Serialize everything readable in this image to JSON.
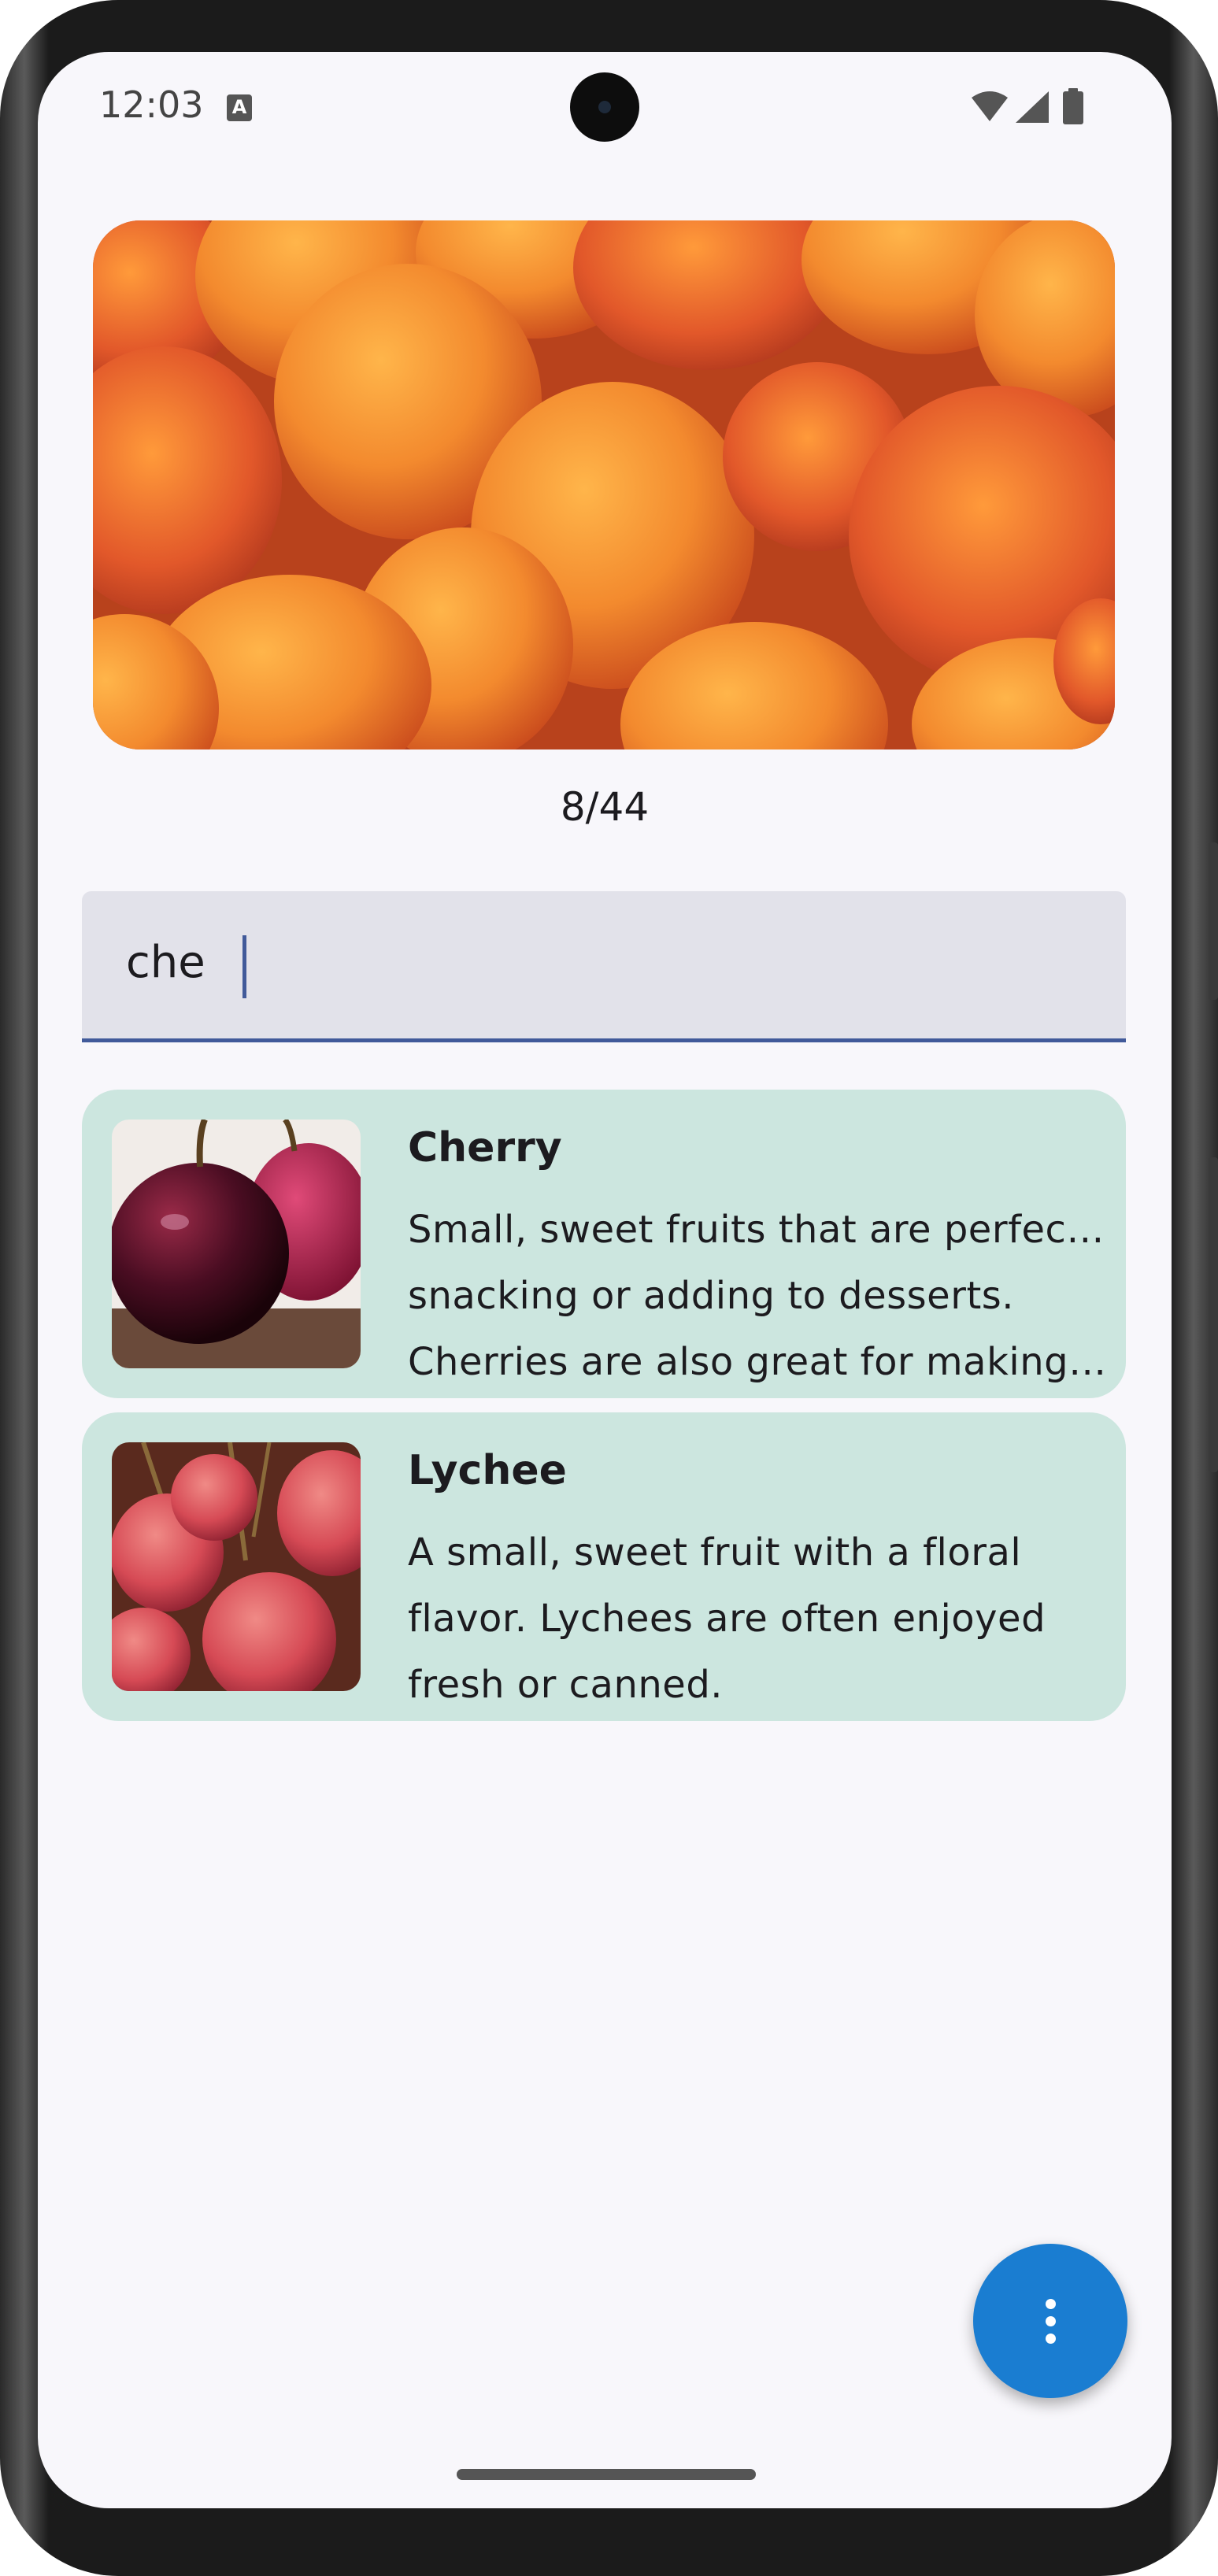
{
  "status_bar": {
    "time": "12:03",
    "notification_icon": "a-accessibility-icon",
    "wifi_icon": "wifi-icon",
    "signal_icon": "signal-icon",
    "battery_icon": "battery-icon"
  },
  "hero": {
    "image_subject": "apricots",
    "counter": "8/44"
  },
  "search": {
    "value": "che"
  },
  "results": [
    {
      "title": "Cherry",
      "description_lines": [
        "Small, sweet fruits that are perfect for",
        "snacking or adding to desserts.",
        "Cherries are also great for making ja…"
      ],
      "image_subject": "cherry"
    },
    {
      "title": "Lychee",
      "description_lines": [
        "A small, sweet fruit with a floral",
        "flavor. Lychees are often enjoyed",
        "fresh or canned."
      ],
      "image_subject": "lychee"
    }
  ],
  "fab": {
    "icon": "more-vert-icon"
  },
  "colors": {
    "screen_bg": "#f8f7fb",
    "card_bg": "#cce6df",
    "search_bg": "#e2e2ea",
    "accent": "#415a9a",
    "fab": "#1a7dd1"
  }
}
